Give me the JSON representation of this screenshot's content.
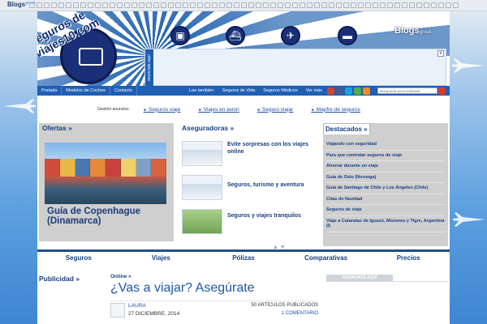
{
  "topbar": {
    "badge_label": "Blogs",
    "badge_sup": "great"
  },
  "header": {
    "site_title": "Seguros de viajes10.com",
    "great_blogs": "Blogs",
    "great_sup": "great",
    "ad_tag": "anunciate aquí",
    "ad_close": "x"
  },
  "nav": {
    "items": [
      "Portada",
      "Modelos de Coches",
      "Contacto"
    ],
    "also_label": "Lee también:",
    "links": [
      "Seguros de Vida",
      "Seguros Médicos",
      "Ver más"
    ],
    "search_placeholder": "Búsqueda personalizada"
  },
  "adrow": {
    "label": "Gestión anuncios",
    "links": [
      "Seguros viaje",
      "Viajes en avion",
      "Seguro viajar",
      "Mapfre de seguros"
    ]
  },
  "ofertas": {
    "title": "Ofertas »",
    "caption": "Guía de Copenhague (Dinamarca)"
  },
  "aseguradoras": {
    "title": "Aseguradoras »",
    "items": [
      "Evite sorpresas con los viajes online",
      "Seguros, turismo y aventura",
      "Seguros y viajes tranquilos"
    ],
    "arrows": "▲  ▼"
  },
  "destacados": {
    "title": "Destacados »",
    "items": [
      "Viajando con seguridad",
      "Para que contratar seguros de viaje",
      "Ahorrar durante un viaje",
      "Guia de Oslo (Noruega)",
      "Guia de Santiago de Chile y Los Ángeles (Chile)",
      "Citas de Navidad",
      "Seguros de viaje",
      "Viaje a Cataratas de Iguazú, Misiones y Tigre, Argentina (I)"
    ]
  },
  "mainmenu": {
    "items": [
      "Seguros",
      "Viajes",
      "Pólizas",
      "Comparativas",
      "Precios"
    ]
  },
  "bottom": {
    "publicidad": "Publicidad »",
    "online": "Online »",
    "title": "¿Vas a viajar? Asegúrate",
    "author": "LAURA",
    "date": "27 DICIEMBRE, 2014",
    "count": "50 ARTÍCULOS PUBLICADOS",
    "comments": "1 COMENTARIO",
    "anuncie": "ANÚNCIATE AQUÍ"
  },
  "colors": {
    "brand_blue": "#1f5fb4",
    "heading_blue": "#173f84",
    "panel_grey": "#cfcfcf"
  },
  "icons": [
    "bus-icon",
    "ship-icon",
    "plane-icon",
    "car-icon",
    "google-plus-icon",
    "facebook-icon",
    "skype-icon",
    "email-icon",
    "rss-icon",
    "search-icon",
    "suitcase-icon"
  ]
}
